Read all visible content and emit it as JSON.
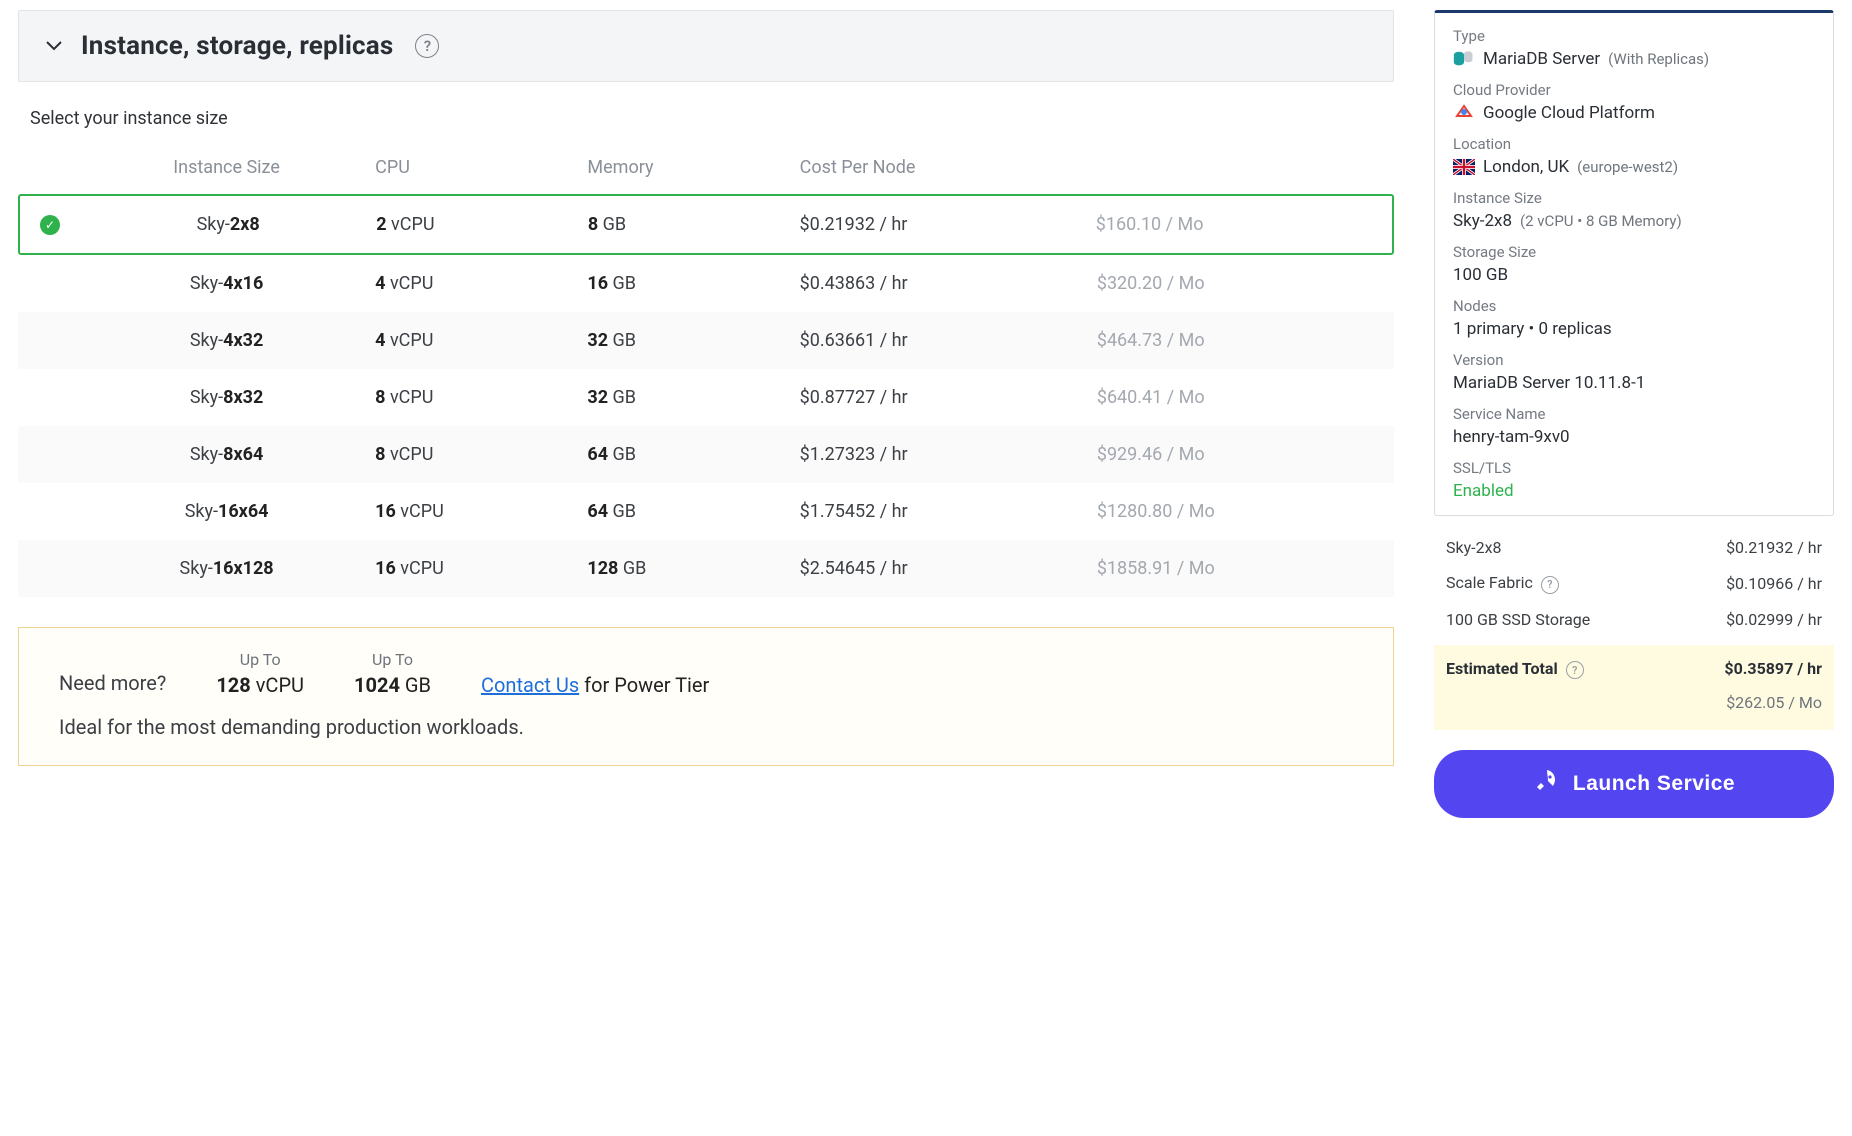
{
  "section": {
    "title": "Instance, storage, replicas",
    "subtitle": "Select your instance size"
  },
  "table": {
    "headers": {
      "size": "Instance Size",
      "cpu": "CPU",
      "memory": "Memory",
      "cost": "Cost Per Node"
    },
    "rows": [
      {
        "selected": true,
        "name_pre": "Sky-",
        "name_bold": "2x8",
        "cpu_num": "2",
        "cpu_unit": "vCPU",
        "mem_num": "8",
        "mem_unit": "GB",
        "hr": "$0.21932 / hr",
        "mo": "$160.10 / Mo"
      },
      {
        "selected": false,
        "name_pre": "Sky-",
        "name_bold": "4x16",
        "cpu_num": "4",
        "cpu_unit": "vCPU",
        "mem_num": "16",
        "mem_unit": "GB",
        "hr": "$0.43863 / hr",
        "mo": "$320.20 / Mo"
      },
      {
        "selected": false,
        "name_pre": "Sky-",
        "name_bold": "4x32",
        "cpu_num": "4",
        "cpu_unit": "vCPU",
        "mem_num": "32",
        "mem_unit": "GB",
        "hr": "$0.63661 / hr",
        "mo": "$464.73 / Mo"
      },
      {
        "selected": false,
        "name_pre": "Sky-",
        "name_bold": "8x32",
        "cpu_num": "8",
        "cpu_unit": "vCPU",
        "mem_num": "32",
        "mem_unit": "GB",
        "hr": "$0.87727 / hr",
        "mo": "$640.41 / Mo"
      },
      {
        "selected": false,
        "name_pre": "Sky-",
        "name_bold": "8x64",
        "cpu_num": "8",
        "cpu_unit": "vCPU",
        "mem_num": "64",
        "mem_unit": "GB",
        "hr": "$1.27323 / hr",
        "mo": "$929.46 / Mo"
      },
      {
        "selected": false,
        "name_pre": "Sky-",
        "name_bold": "16x64",
        "cpu_num": "16",
        "cpu_unit": "vCPU",
        "mem_num": "64",
        "mem_unit": "GB",
        "hr": "$1.75452 / hr",
        "mo": "$1280.80 / Mo"
      },
      {
        "selected": false,
        "name_pre": "Sky-",
        "name_bold": "16x128",
        "cpu_num": "16",
        "cpu_unit": "vCPU",
        "mem_num": "128",
        "mem_unit": "GB",
        "hr": "$2.54645 / hr",
        "mo": "$1858.91 / Mo"
      }
    ]
  },
  "need_more": {
    "label": "Need more?",
    "up_to": "Up To",
    "cpu_num": "128",
    "cpu_unit": "vCPU",
    "mem_num": "1024",
    "mem_unit": "GB",
    "link": "Contact Us",
    "link_suffix": " for Power Tier",
    "bottom": "Ideal for the most demanding production workloads."
  },
  "summary": {
    "type_label": "Type",
    "type_value": "MariaDB Server",
    "type_sub": "(With Replicas)",
    "provider_label": "Cloud Provider",
    "provider_value": "Google Cloud Platform",
    "location_label": "Location",
    "location_value": "London, UK",
    "location_sub": "(europe-west2)",
    "instance_label": "Instance Size",
    "instance_value": "Sky-2x8",
    "instance_sub": "(2 vCPU • 8 GB Memory)",
    "storage_label": "Storage Size",
    "storage_value": "100 GB",
    "nodes_label": "Nodes",
    "nodes_value": "1 primary • 0 replicas",
    "version_label": "Version",
    "version_value": "MariaDB Server 10.11.8-1",
    "service_label": "Service Name",
    "service_value": "henry-tam-9xv0",
    "ssl_label": "SSL/TLS",
    "ssl_value": "Enabled"
  },
  "pricing": {
    "lines": [
      {
        "label": "Sky-2x8",
        "price": "$0.21932 / hr",
        "help": false
      },
      {
        "label": "Scale Fabric",
        "price": "$0.10966 / hr",
        "help": true
      },
      {
        "label": "100 GB SSD Storage",
        "price": "$0.02999 / hr",
        "help": false
      }
    ],
    "total_label": "Estimated Total",
    "total_hr": "$0.35897 / hr",
    "total_mo": "$262.05 / Mo"
  },
  "launch_label": "Launch Service"
}
